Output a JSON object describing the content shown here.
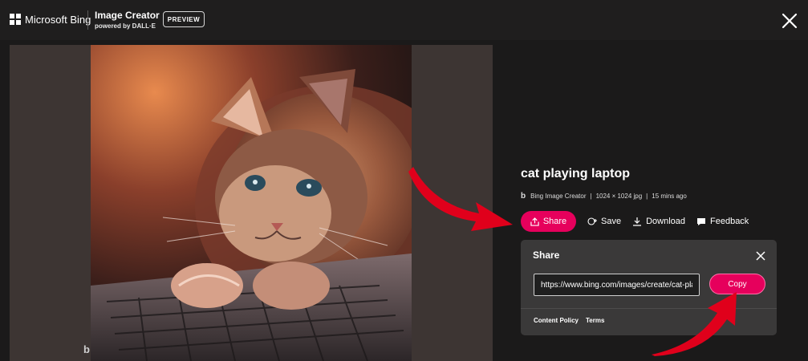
{
  "header": {
    "brand": "Microsoft Bing",
    "product_title": "Image Creator",
    "product_subtitle": "powered by DALL·E",
    "badge": "PREVIEW",
    "close_icon": "close-icon"
  },
  "image": {
    "description_icon": "kitten-on-laptop-artwork",
    "watermark": "b"
  },
  "details": {
    "title": "cat playing laptop",
    "source": "Bing Image Creator",
    "dimensions": "1024 × 1024 jpg",
    "age": "15 mins ago",
    "separator": "|"
  },
  "actions": {
    "share": "Share",
    "save": "Save",
    "download": "Download",
    "feedback": "Feedback"
  },
  "share_panel": {
    "title": "Share",
    "url": "https://www.bing.com/images/create/cat-playing-laptop",
    "copy": "Copy",
    "links": [
      "Content Policy",
      "Terms"
    ]
  },
  "colors": {
    "accent": "#e6005c",
    "annotation_arrow": "#e0001b",
    "background": "#1b1a1a",
    "panel": "#3a3939"
  }
}
